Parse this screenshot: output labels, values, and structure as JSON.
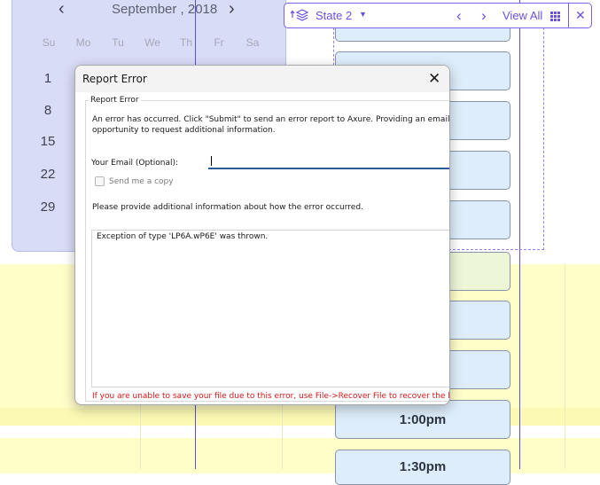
{
  "calendar": {
    "month_label": "September , 2018",
    "weekdays": [
      "Su",
      "Mo",
      "Tu",
      "We",
      "Th",
      "Fr",
      "Sa"
    ],
    "first_column_days": [
      "1",
      "8",
      "15",
      "22",
      "29"
    ]
  },
  "schedule": {
    "time_labels": [
      "1:00pm",
      "1:30pm"
    ]
  },
  "state_toolbar": {
    "state_label": "State 2",
    "view_all_label": "View All"
  },
  "dialog": {
    "title": "Report Error",
    "group_label": "Report Error",
    "intro_line1": "An error has occurred. Click \"Submit\" to send an error report to Axure. Providing an email ac",
    "intro_line2": "opportunity to request additional information.",
    "email_label": "Your Email (Optional):",
    "email_value": "",
    "send_copy_label": "Send me a copy",
    "details_prompt": "Please provide additional information about how the error occurred.",
    "details_text": "Exception of type 'LP6A.wP6E' was thrown.",
    "warning_text": "If you are unable to save your file due to this error, use File->Recover File to recover the late"
  },
  "colors": {
    "accent": "#6a4fe0",
    "calendar_bg": "#d9dcf7",
    "slot_bg": "#deedfb",
    "warning": "#d11818"
  }
}
